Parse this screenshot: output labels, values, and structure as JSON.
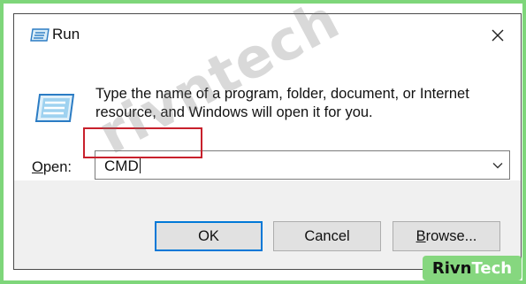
{
  "window": {
    "title": "Run",
    "close_icon": "close-icon"
  },
  "content": {
    "description": "Type the name of a program, folder, document, or Internet resource, and Windows will open it for you.",
    "open_label_accel": "O",
    "open_label_rest": "pen:",
    "input_value": "CMD"
  },
  "buttons": {
    "ok": "OK",
    "cancel": "Cancel",
    "browse_accel": "B",
    "browse_rest": "rowse..."
  },
  "watermark": "rivntech",
  "brand": {
    "part1": "Rivn",
    "part2": "Tech"
  },
  "colors": {
    "frame_border": "#7ed67a",
    "highlight_box": "#c8202c",
    "ok_border": "#0078d7",
    "footer_bg": "#f0f0f0",
    "brand_bg": "#86d77f"
  }
}
